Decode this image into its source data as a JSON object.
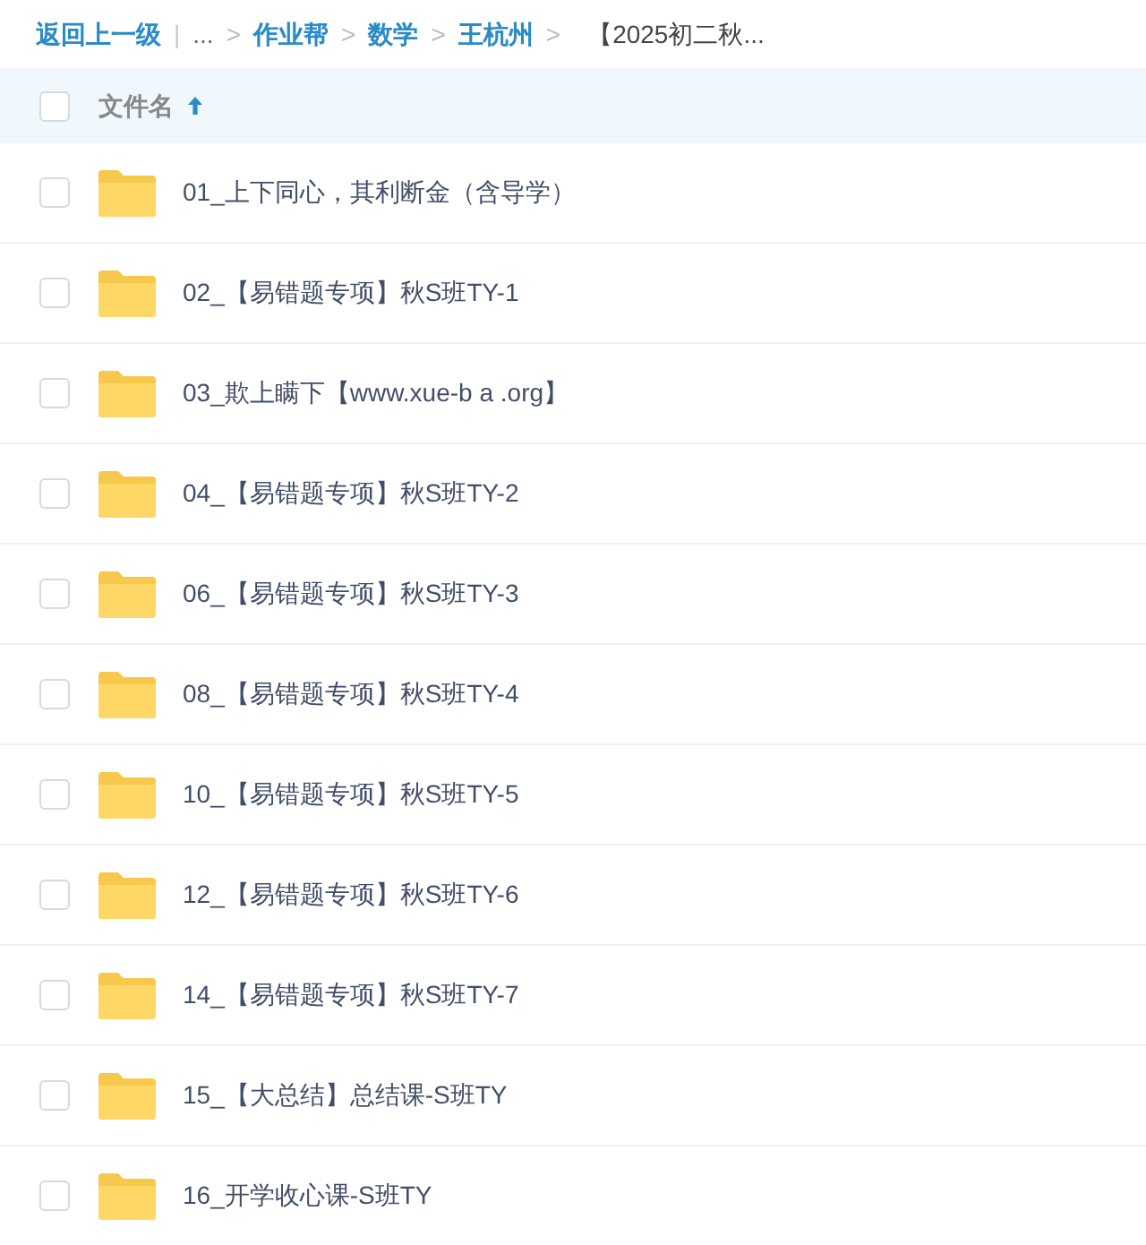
{
  "breadcrumb": [
    {
      "kind": "link",
      "text": "返回上一级"
    },
    {
      "kind": "divider",
      "text": "|"
    },
    {
      "kind": "plain",
      "text": "..."
    },
    {
      "kind": "separator",
      "text": ">"
    },
    {
      "kind": "link",
      "text": "作业帮"
    },
    {
      "kind": "separator",
      "text": ">"
    },
    {
      "kind": "link",
      "text": "数学"
    },
    {
      "kind": "separator",
      "text": ">"
    },
    {
      "kind": "link",
      "text": "王杭州"
    },
    {
      "kind": "separator",
      "text": ">"
    },
    {
      "kind": "current",
      "text": "【2025初二秋..."
    }
  ],
  "header": {
    "checked": false,
    "column": "文件名",
    "sort_ascending": true
  },
  "rows": [
    {
      "name": "01_上下同心，其利断金（含导学）",
      "checked": false
    },
    {
      "name": "02_【易错题专项】秋S班TY-1",
      "checked": false
    },
    {
      "name": "03_欺上瞒下【www.xue-b a .org】",
      "checked": false
    },
    {
      "name": "04_【易错题专项】秋S班TY-2",
      "checked": false
    },
    {
      "name": "06_【易错题专项】秋S班TY-3",
      "checked": false
    },
    {
      "name": "08_【易错题专项】秋S班TY-4",
      "checked": false
    },
    {
      "name": "10_【易错题专项】秋S班TY-5",
      "checked": false
    },
    {
      "name": "12_【易错题专项】秋S班TY-6",
      "checked": false
    },
    {
      "name": "14_【易错题专项】秋S班TY-7",
      "checked": false
    },
    {
      "name": "15_【大总结】总结课-S班TY",
      "checked": false
    },
    {
      "name": "16_开学收心课-S班TY",
      "checked": false
    }
  ]
}
